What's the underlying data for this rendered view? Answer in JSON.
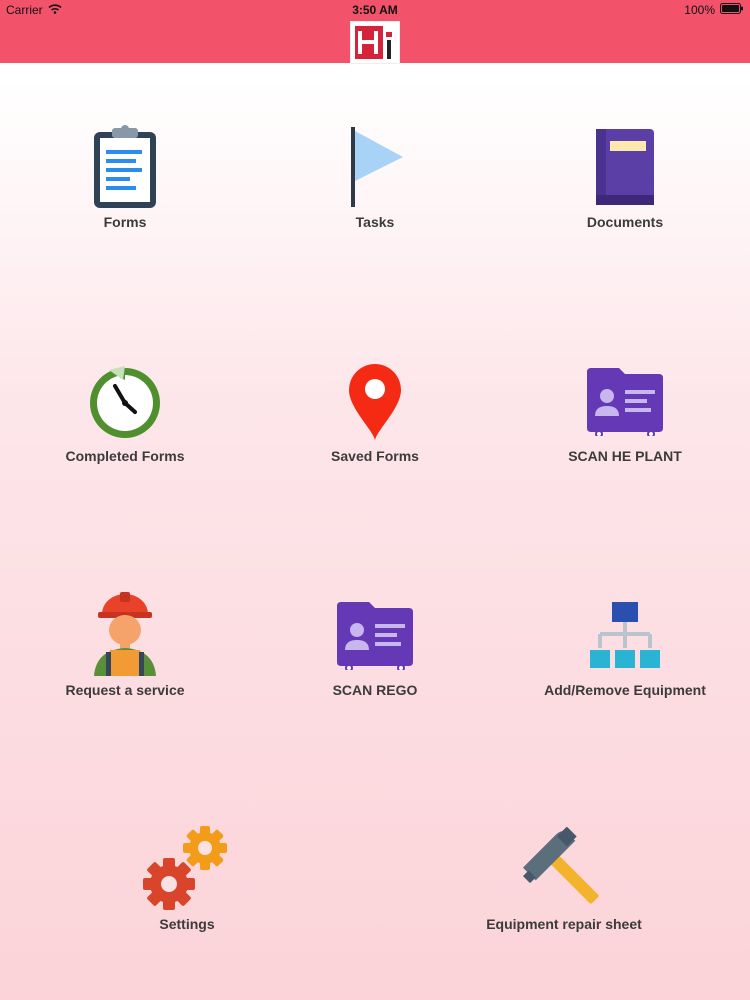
{
  "status_bar": {
    "carrier": "Carrier",
    "time": "3:50 AM",
    "battery": "100%"
  },
  "header": {
    "logo_icon": "hi-logo"
  },
  "menu": [
    {
      "label": "Forms",
      "icon": "clipboard-icon"
    },
    {
      "label": "Tasks",
      "icon": "flag-icon"
    },
    {
      "label": "Documents",
      "icon": "book-icon"
    },
    {
      "label": "Completed Forms",
      "icon": "clock-icon"
    },
    {
      "label": "Saved Forms",
      "icon": "location-pin-icon"
    },
    {
      "label": "SCAN HE PLANT",
      "icon": "id-card-icon"
    },
    {
      "label": "Request a service",
      "icon": "worker-icon"
    },
    {
      "label": "SCAN REGO",
      "icon": "id-card-icon"
    },
    {
      "label": "Add/Remove Equipment",
      "icon": "hierarchy-icon"
    },
    {
      "label": "Settings",
      "icon": "gears-icon"
    },
    {
      "label": "Equipment repair sheet",
      "icon": "hammer-icon"
    }
  ],
  "colors": {
    "header": "#f2536b",
    "label": "#3b3b3b"
  }
}
